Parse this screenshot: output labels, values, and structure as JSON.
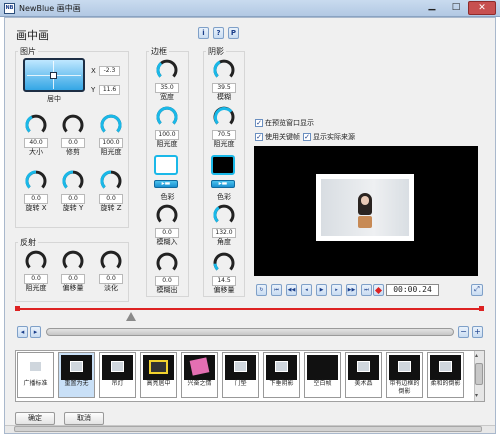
{
  "window": {
    "title": "NewBlue 画中画",
    "app_badge": "NB"
  },
  "header": {
    "title": "画中画"
  },
  "help_buttons": [
    "i",
    "?",
    "P"
  ],
  "image_group": {
    "title": "图片",
    "x_label": "X",
    "x_value": "-2.3",
    "y_label": "Y",
    "y_value": "11.6",
    "position_label": "居中",
    "knobs": [
      {
        "value": "40.0",
        "label": "大小",
        "level": 0.4
      },
      {
        "value": "0.0",
        "label": "修剪",
        "level": 0.0
      },
      {
        "value": "100.0",
        "label": "阻光度",
        "level": 1.0
      },
      {
        "value": "0.0",
        "label": "旋转 X",
        "level": 0.5
      },
      {
        "value": "0.0",
        "label": "旋转 Y",
        "level": 0.5
      },
      {
        "value": "0.0",
        "label": "旋转 Z",
        "level": 0.5
      }
    ]
  },
  "reflection_group": {
    "title": "反射",
    "knobs": [
      {
        "value": "0.0",
        "label": "阻光度",
        "level": 0.0
      },
      {
        "value": "0.0",
        "label": "偏移量",
        "level": 0.0
      },
      {
        "value": "0.0",
        "label": "淡化",
        "level": 0.0
      }
    ]
  },
  "border_group": {
    "title": "边框",
    "knobs": [
      {
        "value": "35.0",
        "label": "宽度",
        "level": 0.35
      },
      {
        "value": "100.0",
        "label": "阻光度",
        "level": 1.0
      }
    ],
    "color_label": "色彩",
    "color": "#ffffff",
    "knobs2": [
      {
        "value": "0.0",
        "label": "模糊入",
        "level": 0.0
      },
      {
        "value": "0.0",
        "label": "模糊出",
        "level": 0.0
      }
    ]
  },
  "shadow_group": {
    "title": "阴影",
    "knobs": [
      {
        "value": "39.5",
        "label": "模糊",
        "level": 0.4
      },
      {
        "value": "70.5",
        "label": "阻光度",
        "level": 0.7
      }
    ],
    "color_label": "色彩",
    "color": "#000000",
    "knobs2": [
      {
        "value": "132.0",
        "label": "角度",
        "level": 0.37
      },
      {
        "value": "14.5",
        "label": "偏移量",
        "level": 0.15
      }
    ]
  },
  "options": [
    {
      "label": "在预览窗口显示",
      "checked": true
    },
    {
      "label": "使用关键帧",
      "checked": true
    },
    {
      "label": "显示实际来源",
      "checked": true
    }
  ],
  "timecode": "00:00.24",
  "presets": [
    {
      "label": "广播标准"
    },
    {
      "label": "重置为无"
    },
    {
      "label": "吊灯"
    },
    {
      "label": "高亮居中"
    },
    {
      "label": "兴奋之情"
    },
    {
      "label": "门垫"
    },
    {
      "label": "下垂阴影"
    },
    {
      "label": "空白帧"
    },
    {
      "label": "美术品"
    },
    {
      "label": "带有边框的倒影"
    },
    {
      "label": "柔和的倒影"
    }
  ],
  "buttons": {
    "ok": "确定",
    "cancel": "取消"
  },
  "colors": {
    "accent": "#1ab8e8",
    "selected_thumb": "#c9e0f7"
  }
}
